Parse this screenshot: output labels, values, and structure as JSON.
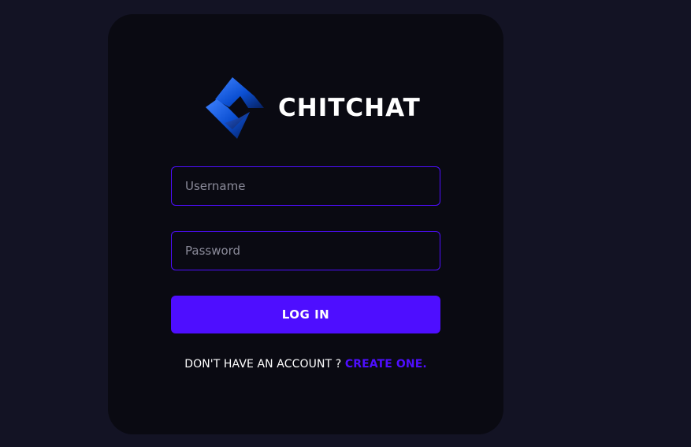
{
  "app": {
    "title": "CHITCHAT",
    "logo_icon": "chitchat-logo-icon"
  },
  "form": {
    "username": {
      "placeholder": "Username",
      "value": ""
    },
    "password": {
      "placeholder": "Password",
      "value": ""
    },
    "login_label": "LOG IN",
    "signup_prompt": "DON'T HAVE AN ACCOUNT ?",
    "signup_link": "CREATE ONE."
  },
  "colors": {
    "background": "#131324",
    "card": "#0a0a12",
    "accent": "#4e0eff",
    "text": "#ffffff"
  }
}
